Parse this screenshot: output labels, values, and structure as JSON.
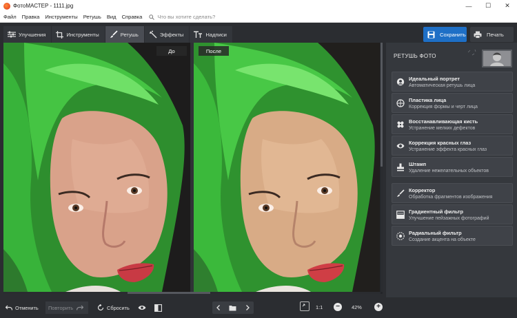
{
  "window": {
    "title": "ФотоМАСТЕР - 1111.jpg",
    "controls": [
      "—",
      "☐",
      "✕"
    ]
  },
  "menu": {
    "items": [
      "Файл",
      "Правка",
      "Инструменты",
      "Ретушь",
      "Вид",
      "Справка"
    ],
    "search_placeholder": "Что вы хотите сделать?"
  },
  "toolbar": {
    "tabs": [
      {
        "label": "Улучшения",
        "icon": "sliders-icon"
      },
      {
        "label": "Инструменты",
        "icon": "crop-icon"
      },
      {
        "label": "Ретушь",
        "icon": "brush-icon",
        "active": true
      },
      {
        "label": "Эффекты",
        "icon": "magic-wand-icon"
      },
      {
        "label": "Надписи",
        "icon": "text-icon"
      }
    ],
    "save_label": "Сохранить",
    "print_label": "Печать",
    "accent": "#1e6fc6"
  },
  "workspace": {
    "before_label": "До",
    "after_label": "После"
  },
  "panel": {
    "title": "РЕТУШЬ ФОТО",
    "tools": [
      {
        "name": "Идеальный портрет",
        "desc": "Автоматическая ретушь лица",
        "icon": "portrait-icon"
      },
      {
        "name": "Пластика лица",
        "desc": "Коррекция формы и черт лица",
        "icon": "face-plastic-icon"
      },
      {
        "name": "Восстанавливающая кисть",
        "desc": "Устранение мелких дефектов",
        "icon": "bandage-icon"
      },
      {
        "name": "Коррекция красных глаз",
        "desc": "Устранение эффекта красных глаз",
        "icon": "eye-icon"
      },
      {
        "name": "Штамп",
        "desc": "Удаление нежелательных объектов",
        "icon": "stamp-icon"
      }
    ],
    "tools2": [
      {
        "name": "Корректор",
        "desc": "Обработка фрагментов изображения",
        "icon": "brush-icon"
      },
      {
        "name": "Градиентный фильтр",
        "desc": "Улучшение пейзажных фотографий",
        "icon": "gradient-icon"
      },
      {
        "name": "Радиальный фильтр",
        "desc": "Создание акцента на объекте",
        "icon": "radial-icon"
      }
    ]
  },
  "bottombar": {
    "undo_label": "Отменить",
    "redo_label": "Повторить",
    "reset_label": "Сбросить",
    "zoom_1to1": "1:1",
    "zoom_value": "42%"
  }
}
